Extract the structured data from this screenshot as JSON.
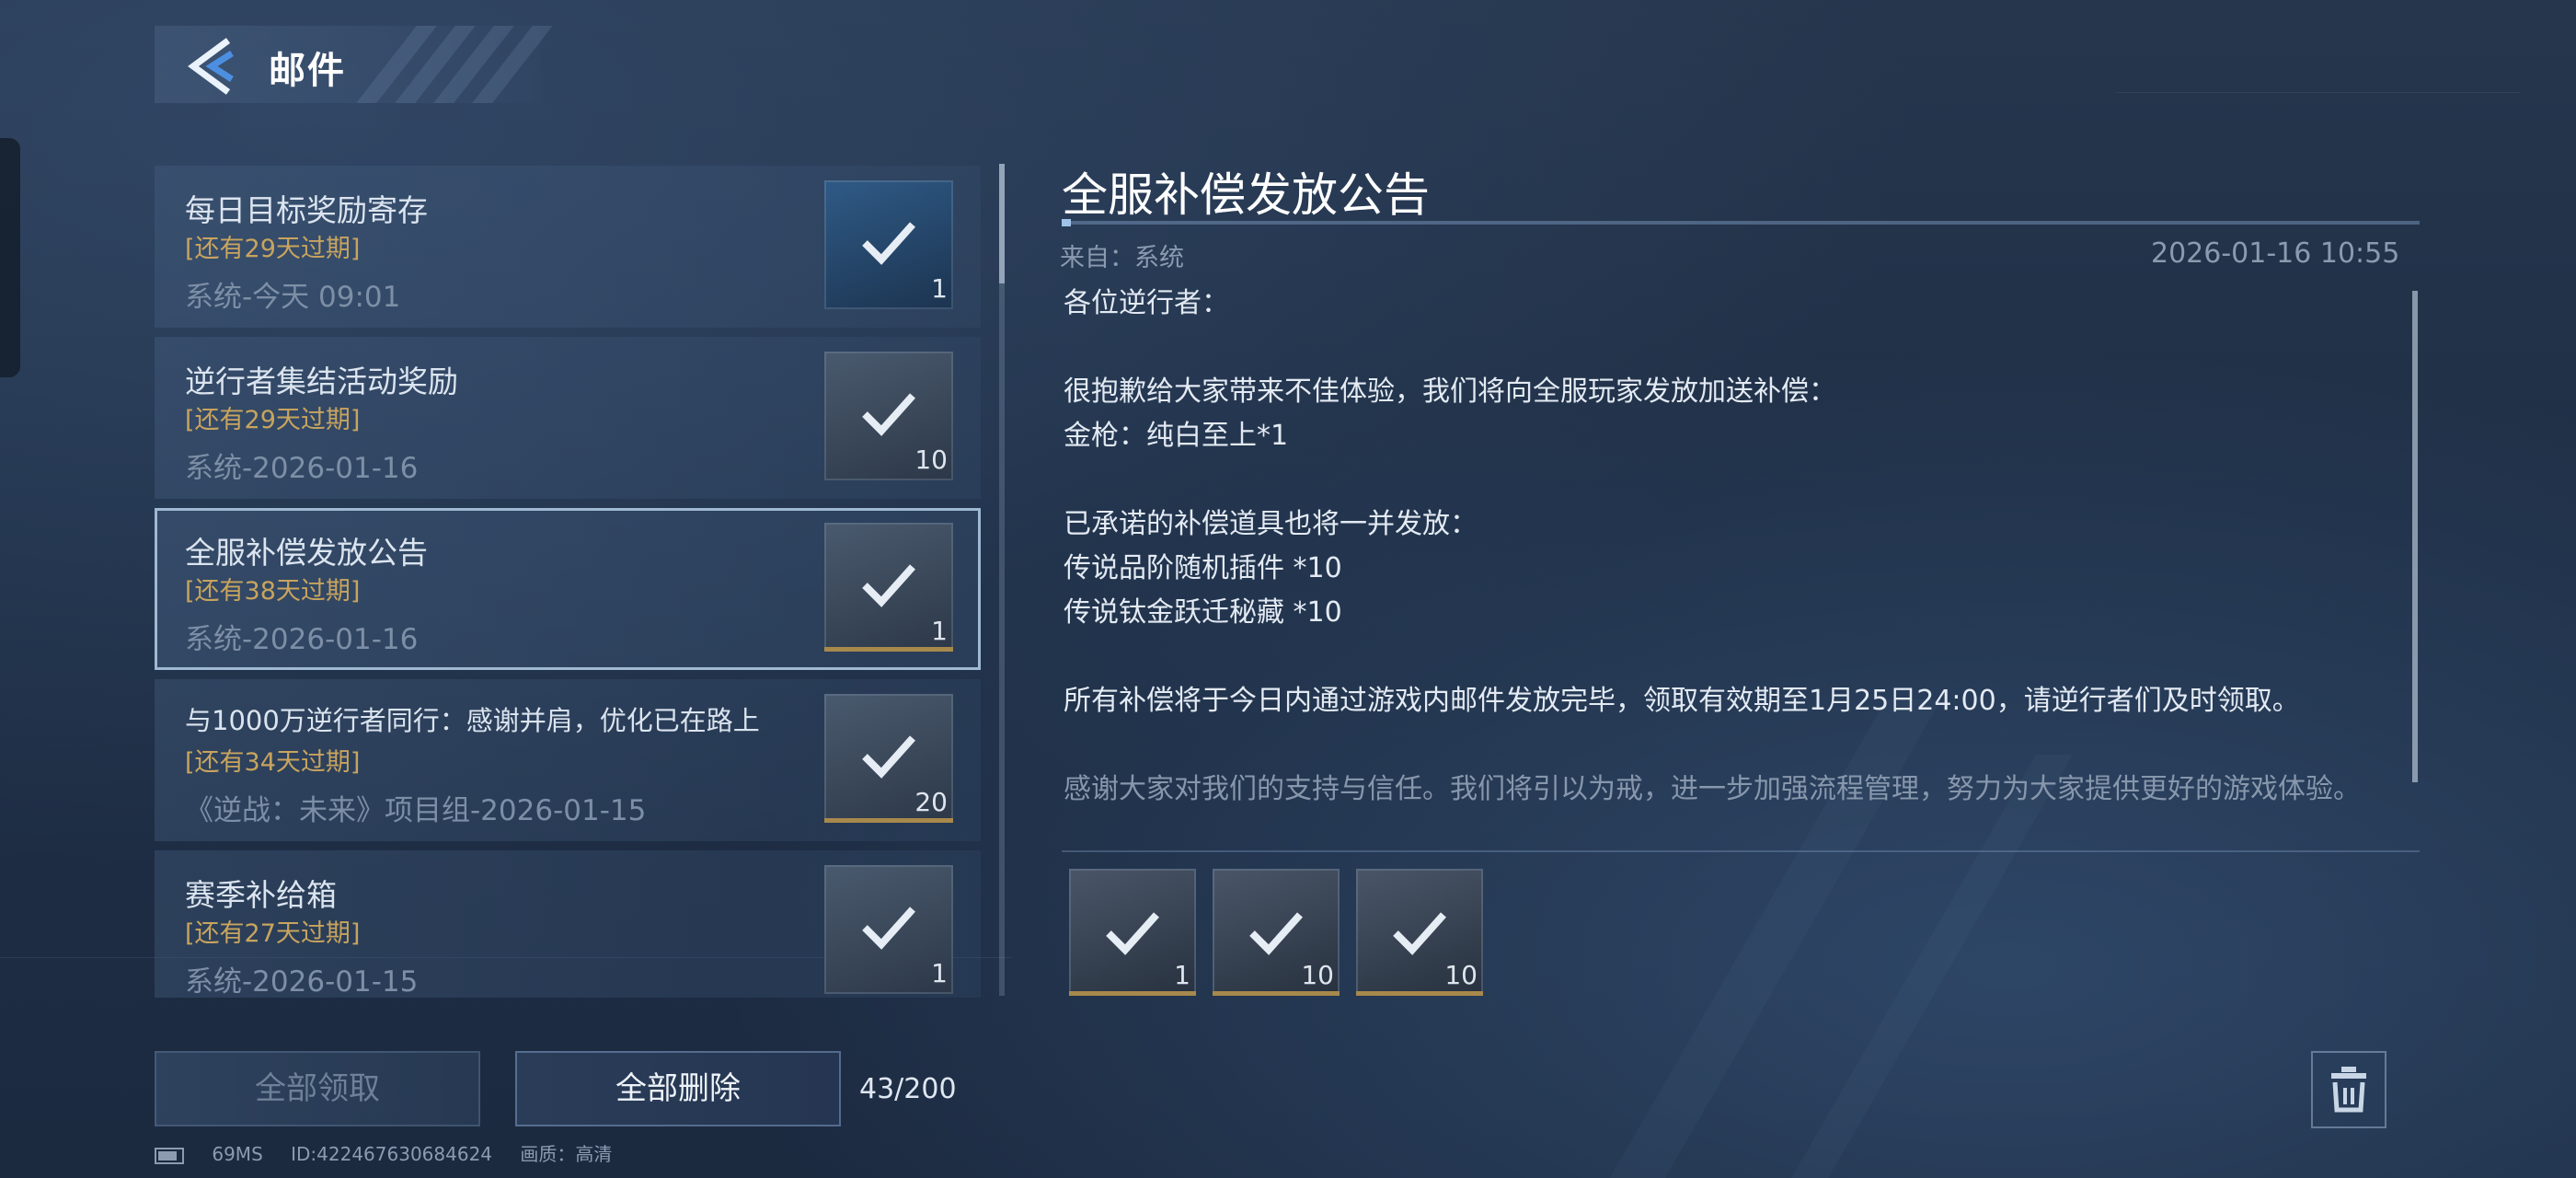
{
  "header": {
    "title": "邮件",
    "back_icon": "back-arrow-icon"
  },
  "mail_list": {
    "items": [
      {
        "title": "每日目标奖励寄存",
        "expire": "[还有29天过期]",
        "meta": "系统-今天 09:01",
        "qty": "1",
        "icon": "equipment-crate-icon",
        "claimed": true,
        "selected": false
      },
      {
        "title": "逆行者集结活动奖励",
        "expire": "[还有29天过期]",
        "meta": "系统-2026-01-16",
        "qty": "10",
        "icon": "ticket-card-icon",
        "claimed": true,
        "selected": false
      },
      {
        "title": "全服补偿发放公告",
        "expire": "[还有38天过期]",
        "meta": "系统-2026-01-16",
        "qty": "1",
        "icon": "rifle-icon",
        "claimed": true,
        "selected": true
      },
      {
        "title": "与1000万逆行者同行：感谢并肩，优化已在路上",
        "expire": "[还有34天过期]",
        "meta": "《逆战：未来》项目组-2026-01-15",
        "qty": "20",
        "icon": "medal-coin-icon",
        "claimed": true,
        "selected": false
      },
      {
        "title": "赛季补给箱",
        "expire": "[还有27天过期]",
        "meta": "系统-2026-01-15",
        "qty": "1",
        "icon": "supply-box-icon",
        "claimed": true,
        "selected": false
      }
    ]
  },
  "detail": {
    "title": "全服补偿发放公告",
    "from": "来自：系统",
    "date": "2026-01-16 10:55",
    "body": [
      "各位逆行者：",
      "",
      "很抱歉给大家带来不佳体验，我们将向全服玩家发放加送补偿：",
      "金枪：纯白至上*1",
      "",
      "已承诺的补偿道具也将一并发放：",
      "传说品阶随机插件 *10",
      "传说钛金跃迁秘藏 *10",
      "",
      "所有补偿将于今日内通过游戏内邮件发放完毕，领取有效期至1月25日24:00，请逆行者们及时领取。",
      "",
      "感谢大家对我们的支持与信任。我们将引以为戒，进一步加强流程管理，努力为大家提供更好的游戏体验。"
    ],
    "attachments": [
      {
        "icon": "gold-rifle-icon",
        "qty": "1"
      },
      {
        "icon": "legendary-plugin-icon",
        "qty": "10"
      },
      {
        "icon": "titanium-cache-icon",
        "qty": "10"
      }
    ]
  },
  "footer": {
    "claim_all_label": "全部领取",
    "delete_all_label": "全部删除",
    "mail_count": "43/200",
    "trash_icon": "trash-icon"
  },
  "status": {
    "ping": "69MS",
    "id": "ID:422467630684624",
    "quality": "画质：高清"
  },
  "colors": {
    "expire_text": "#c8a45e",
    "selected_border": "#9fb9d2",
    "background": "#1f2f46"
  }
}
